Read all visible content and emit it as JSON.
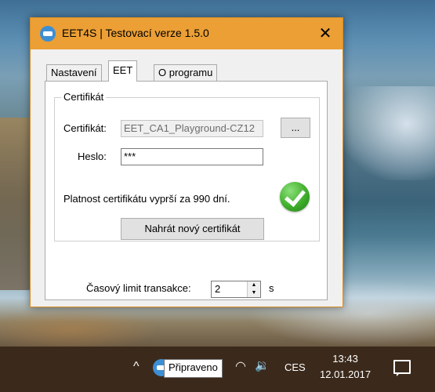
{
  "window": {
    "title": "EET4S | Testovací verze 1.5.0",
    "close_glyph": "✕"
  },
  "tabs": [
    {
      "label": "Nastavení",
      "active": false
    },
    {
      "label": "EET",
      "active": true
    },
    {
      "label": "O programu",
      "active": false
    }
  ],
  "certificate_group": {
    "legend": "Certifikát",
    "certificate_label": "Certifikát:",
    "certificate_value": "EET_CA1_Playground-CZ12",
    "browse_label": "...",
    "password_label": "Heslo:",
    "password_value": "***",
    "validity_text": "Platnost certifikátu vyprší za 990 dní.",
    "status_icon": "check-icon",
    "upload_label": "Nahrát nový certifikát"
  },
  "timeout": {
    "label": "Časový limit transakce:",
    "value": "2",
    "unit": "s"
  },
  "taskbar": {
    "chevron": "^",
    "tooltip": "Připraveno",
    "wifi_glyph": "◠",
    "volume_glyph": "🔉",
    "language": "CES",
    "time": "13:43",
    "date": "12.01.2017"
  },
  "colors": {
    "title_bar": "#eb9f35",
    "taskbar": "#3b2a1b",
    "status_ok": "#3fae2a"
  }
}
